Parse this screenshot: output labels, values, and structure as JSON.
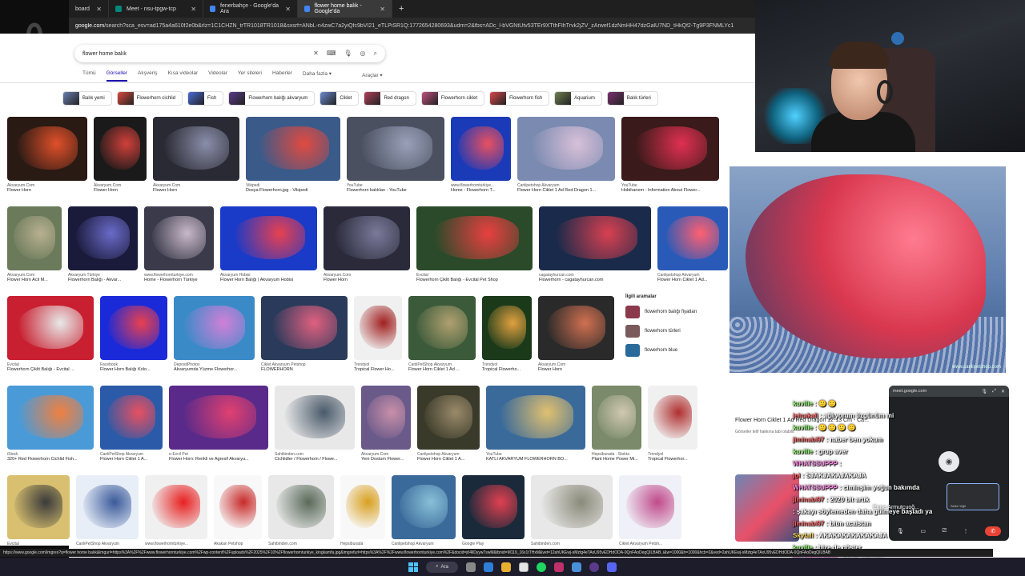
{
  "browser": {
    "tabs": [
      {
        "label": "board",
        "active": false
      },
      {
        "label": "Meet - nsu-tpgw-tcp",
        "active": false
      },
      {
        "label": "fenerbahçe - Google'da Ara",
        "active": false
      },
      {
        "label": "flower home balık - Google'da",
        "active": true
      }
    ],
    "new_tab": "+",
    "url_host": "google.com",
    "url_rest": "/search?sca_esv=ad175a4a610f2e0b&rlz=1C1CHZN_trTR1018TR1018&sxsrf=ANbL-n4zwC7a2yiQfc9bVI21_eTLPiSR1Q:1772654280693&udm=2&fbs=ADc_l-bVGNtUtv53TEr9XTthFIhTrvk2jZV_zArwef1dzNmHH47dzGalU7ND_tHkQf2-Tg9P3FNMLYc1"
  },
  "google": {
    "query": "flower home balık",
    "search_icons": [
      "keyboard-icon",
      "close-icon",
      "mic-icon",
      "lens-icon",
      "search-icon"
    ],
    "nav": [
      "Tümü",
      "Görseller",
      "Alışveriş",
      "Kısa videolar",
      "Videolar",
      "Yer siteleri",
      "Haberler",
      "Daha fazla ▾"
    ],
    "nav_active": "Görseller",
    "tools": "Araçlar ▾",
    "chips": [
      {
        "label": "Balık yemi",
        "color": "#6a7fb0"
      },
      {
        "label": "Flowerhorn cichlid",
        "color": "#d94a3c"
      },
      {
        "label": "Fish",
        "color": "#4a6bd8"
      },
      {
        "label": "Flowerhorn balığı akvaryum",
        "color": "#5a3a8a"
      },
      {
        "label": "Ciklet",
        "color": "#6a8ad0"
      },
      {
        "label": "Red dragon",
        "color": "#b0405a"
      },
      {
        "label": "Flowerhorn ciklet",
        "color": "#c05080"
      },
      {
        "label": "Flowerhorn fish",
        "color": "#d9484a"
      },
      {
        "label": "Aquarium",
        "color": "#708050"
      },
      {
        "label": "Balık türleri",
        "color": "#7a3070"
      }
    ],
    "rows": [
      [
        {
          "src": "Akvaryum.Com",
          "cap": "Flower Horn",
          "w": 100,
          "h": 80,
          "bg": "#2a1a14",
          "fc": "#e0502a"
        },
        {
          "src": "Akvaryum.Com",
          "cap": "Flower Horn",
          "w": 66,
          "h": 80,
          "bg": "#1a1a1a",
          "fc": "#d0403a"
        },
        {
          "src": "Akvaryum.Com",
          "cap": "Flower Horn",
          "w": 108,
          "h": 80,
          "bg": "#2a2a34",
          "fc": "#8a8ea8"
        },
        {
          "src": "Vikipedi",
          "cap": "Dosya:Flowerhorn.jpg - Vikipedi",
          "w": 118,
          "h": 80,
          "bg": "#3a5a8a",
          "fc": "#e04a40"
        },
        {
          "src": "YouTube",
          "cap": "Flowerhorn balıkları - YouTube",
          "w": 122,
          "h": 80,
          "bg": "#4a5060",
          "fc": "#9aa0b8"
        },
        {
          "src": "www.flowerhornturkiye...",
          "cap": "Home - Flowerhorn T...",
          "w": 75,
          "h": 80,
          "bg": "#1a3ab8",
          "fc": "#e85060"
        },
        {
          "src": "Canlipetshop Akvaryum",
          "cap": "Flower Horn Ciklet 1 Ad Red Dragon 1...",
          "w": 122,
          "h": 80,
          "bg": "#7a8ab0",
          "fc": "#d8c0d8"
        },
        {
          "src": "YouTube",
          "cap": "Hobihanem - Information About Flower...",
          "w": 122,
          "h": 80,
          "bg": "#3a1a1a",
          "fc": "#e03050"
        }
      ],
      [
        {
          "src": "Akvaryum.Com",
          "cap": "Flower Horn Acil M...",
          "w": 68,
          "h": 80,
          "bg": "#6a7a5a",
          "fc": "#b8b090"
        },
        {
          "src": "Akvaryum Türkiye",
          "cap": "Flowerhorn Balığı - Akvar...",
          "w": 87,
          "h": 80,
          "bg": "#1a1a3a",
          "fc": "#6a6ac8"
        },
        {
          "src": "www.flowerhornturkiye.com",
          "cap": "Home - Flowerhorn Türkiye",
          "w": 87,
          "h": 80,
          "bg": "#3a3a4a",
          "fc": "#c8b8c8"
        },
        {
          "src": "Akvaryum Hobisi",
          "cap": "Flower Horn Balığı | Akvaryum Hobisi",
          "w": 121,
          "h": 80,
          "bg": "#1a3ac8",
          "fc": "#e84050"
        },
        {
          "src": "Akvaryum.Com",
          "cap": "Flower Horn",
          "w": 108,
          "h": 80,
          "bg": "#2a2a3a",
          "fc": "#7a7a9a"
        },
        {
          "src": "Evcital",
          "cap": "Flowerhorn Çiklit Balığı - Evcital Pet Shop",
          "w": 145,
          "h": 80,
          "bg": "#2a4a2a",
          "fc": "#e84040"
        },
        {
          "src": "cagatayhurcan.com",
          "cap": "Flowerhorn - cagatayhurcan.com",
          "w": 140,
          "h": 80,
          "bg": "#1a2a4a",
          "fc": "#d84050"
        },
        {
          "src": "Canlipetshop Akvaryum",
          "cap": "Flower Horn Ciklet 1 Ad...",
          "w": 88,
          "h": 80,
          "bg": "#2a5ab8",
          "fc": "#ff6070"
        }
      ],
      [
        {
          "src": "Evcital",
          "cap": "Flowerhorn Çiklit Balığı - Evcital ...",
          "w": 108,
          "h": 80,
          "bg": "#c82030",
          "fc": "#e8e8e8"
        },
        {
          "src": "Facebook",
          "cap": "Flower Horn Balığı Kolo...",
          "w": 84,
          "h": 80,
          "bg": "#1a2ad8",
          "fc": "#e84050"
        },
        {
          "src": "DepositPhotos",
          "cap": "Akvaryumda Yüzme Flowerhor...",
          "w": 101,
          "h": 80,
          "bg": "#3a8ac8",
          "fc": "#d080d8"
        },
        {
          "src": "Ciklet Akvaryum Petshop",
          "cap": "FLOWERHORN",
          "w": 108,
          "h": 80,
          "bg": "#2a3a5a",
          "fc": "#e06080"
        },
        {
          "src": "Trendyol",
          "cap": "Tropical Flower Ho...",
          "w": 60,
          "h": 80,
          "bg": "#f0f0f0",
          "fc": "#a02020"
        },
        {
          "src": "CanliPetShop Akvaryum",
          "cap": "Flower Horn Ciklet 1 Ad ...",
          "w": 84,
          "h": 80,
          "bg": "#3a5a3a",
          "fc": "#b0a070"
        },
        {
          "src": "Trendyol",
          "cap": "Tropical Flowerho...",
          "w": 62,
          "h": 80,
          "bg": "#1a3a1a",
          "fc": "#e0a040"
        },
        {
          "src": "Akvaryum.Com",
          "cap": "Flower Horn",
          "w": 95,
          "h": 80,
          "bg": "#2a2a2a",
          "fc": "#d07050"
        }
      ],
      [
        {
          "src": "iStock",
          "cap": "320+ Red Flowerhorn Cichlid Fish...",
          "w": 108,
          "h": 80,
          "bg": "#4a9ad8",
          "fc": "#f08040"
        },
        {
          "src": "CanliPetShop Akvaryum",
          "cap": "Flower Horn Ciklet 1 A...",
          "w": 78,
          "h": 80,
          "bg": "#2a5aa8",
          "fc": "#e85060"
        },
        {
          "src": "e-Evcil Pet",
          "cap": "Flower Horn: Renkli ve Agresif Akvaryu...",
          "w": 124,
          "h": 80,
          "bg": "#5a2a8a",
          "fc": "#e04070"
        },
        {
          "src": "Sahibinden.com",
          "cap": "Cichlidler / Flowerhorn / Flowe...",
          "w": 100,
          "h": 80,
          "bg": "#e8e8e8",
          "fc": "#4a5a6a"
        },
        {
          "src": "Akvaryum.Com",
          "cap": "Yeni Dostum Flower...",
          "w": 62,
          "h": 80,
          "bg": "#6a5a8a",
          "fc": "#c890a8"
        },
        {
          "src": "Canlipetshop Akvaryum",
          "cap": "Flower Horn Ciklet 1 A...",
          "w": 78,
          "h": 80,
          "bg": "#3a3a2a",
          "fc": "#9a8a6a"
        },
        {
          "src": "YouTube",
          "cap": "KATLI AKVARYUM FLOWERHORN BO...",
          "w": 124,
          "h": 80,
          "bg": "#3a6a9a",
          "fc": "#e0c070"
        },
        {
          "src": "Hepsiburada · Stokta",
          "cap": "Plant Home Power Mi...",
          "w": 62,
          "h": 80,
          "bg": "#7a8a6a",
          "fc": "#d0c8b0"
        },
        {
          "src": "Trendyol",
          "cap": "Tropical Flowerhor...",
          "w": 62,
          "h": 80,
          "bg": "#f0f0f0",
          "fc": "#b03030"
        }
      ],
      [
        {
          "src": "Evcital",
          "cap": "",
          "w": 78,
          "h": 80,
          "bg": "#d8c070",
          "fc": "#3a3a3a"
        },
        {
          "src": "CanliPetShop Akvaryum",
          "cap": "",
          "w": 78,
          "h": 80,
          "bg": "#e8eef8",
          "fc": "#3a5a9a"
        },
        {
          "src": "www.flowerhorntürkiye...",
          "cap": "",
          "w": 78,
          "h": 80,
          "bg": "#f0f0f0",
          "fc": "#e82020"
        },
        {
          "src": "Akakan Petshop",
          "cap": "",
          "w": 60,
          "h": 80,
          "bg": "#f8f8f8",
          "fc": "#c82a2a"
        },
        {
          "src": "Sahibinden.com",
          "cap": "",
          "w": 82,
          "h": 80,
          "bg": "#e8e8e8",
          "fc": "#5a6a5a"
        },
        {
          "src": "Hepsiburada",
          "cap": "",
          "w": 56,
          "h": 80,
          "bg": "#f8f8f8",
          "fc": "#d8a020"
        },
        {
          "src": "Canlipetshop Akvaryum",
          "cap": "",
          "w": 80,
          "h": 80,
          "bg": "#3a6a9a",
          "fc": "#8ac0d8"
        },
        {
          "src": "Google Play",
          "cap": "",
          "w": 78,
          "h": 80,
          "bg": "#1a2a3a",
          "fc": "#e04050"
        },
        {
          "src": "Sahibinden.com",
          "cap": "",
          "w": 102,
          "h": 80,
          "bg": "#e8e8e8",
          "fc": "#8a8a7a"
        },
        {
          "src": "Ciklet Akvaryum Petsh...",
          "cap": "",
          "w": 78,
          "h": 80,
          "bg": "#f0f0f8",
          "fc": "#c04a8a"
        }
      ]
    ],
    "related": {
      "title": "İlgili aramalar",
      "items": [
        {
          "label": "flowerhorn balığı fiyatları",
          "color": "#8a3a4a"
        },
        {
          "label": "flowerhorn türleri",
          "color": "#7a5a5a"
        },
        {
          "label": "flowerhorn blue",
          "color": "#2a6a9a"
        }
      ]
    },
    "preview": {
      "watermark": "www.canlipetshop.com",
      "title": "Flower Horn Ciklet 1 Ad Red Dragon 12-13 Cm - Ca...",
      "subtitle": "Görseller telif hakkına tabi olabilir."
    }
  },
  "meet": {
    "title": "meet.google.com",
    "self_label": "Selim Yiğit",
    "presenter": "Emre Armutçuoğ..."
  },
  "chat": [
    {
      "user": "kuvilie",
      "text": ": 🙂 🙂",
      "c": "g"
    },
    {
      "user": "jeinakali",
      "text": ": ağlıyorum üzgünüm mi",
      "c": ""
    },
    {
      "user": "kuvilie",
      "text": ": 🙂 🙂 🙂 🙂",
      "c": "g"
    },
    {
      "user": "jiminabi97",
      "text": ": naber ben yokum",
      "c": ""
    },
    {
      "user": "kuvilie",
      "text": ": grup aver",
      "c": "g"
    },
    {
      "user": "WHATSSUPPP",
      "text": ":",
      "c": "p"
    },
    {
      "user": "jol",
      "text": ": SJAKJAKAJAKAJA",
      "c": ""
    },
    {
      "user": "WHATSSUPPP",
      "text": ": ciminşim yoğun bakımda",
      "c": "p"
    },
    {
      "user": "jiminabi97",
      "text": ": 2020 bit artık",
      "c": ""
    },
    {
      "user": "",
      "text": ": şakayı söylemeden daha gülmeye başladı ya",
      "c": ""
    },
    {
      "user": "jiminabi97",
      "text": ": bitm acaistan",
      "c": ""
    },
    {
      "user": "Skyfall",
      "text": ": AKAKAKAKAKAKAJA",
      "c": "y"
    },
    {
      "user": "kuvilie",
      "text": ": bize de göster",
      "c": "g"
    },
    {
      "user": "WHATSSUPPP",
      "text": ": bizde görelim",
      "c": "p"
    }
  ],
  "status_url": "https://www.google.com/imgres?q=flower home balık&imgurl=https%3A%2F%2Fwww.flowerhornturkiye.com%2Fwp-content%2Fuploads%2F2025%2F10%2Fflowerhornturkiye_kingkamfa.jpg&imgrefurl=https%3A%2F%2Fwww.flowerhornturkiye.com%2F&docid=jrl4liDyyw7swM&tbnid=M119_16x1tTHxM&vet=12ahUKEwj-sMztg4eTAxU95vEDHdODA-0QnFAoDegQILBAB..i&w=1000&h=1000&hcb=2&ved=2ahUKEwj-sMztg4eTAxU95vEDHdODA-0QnFAoDegQILBAB",
  "taskbar": {
    "search_label": "Ara"
  }
}
